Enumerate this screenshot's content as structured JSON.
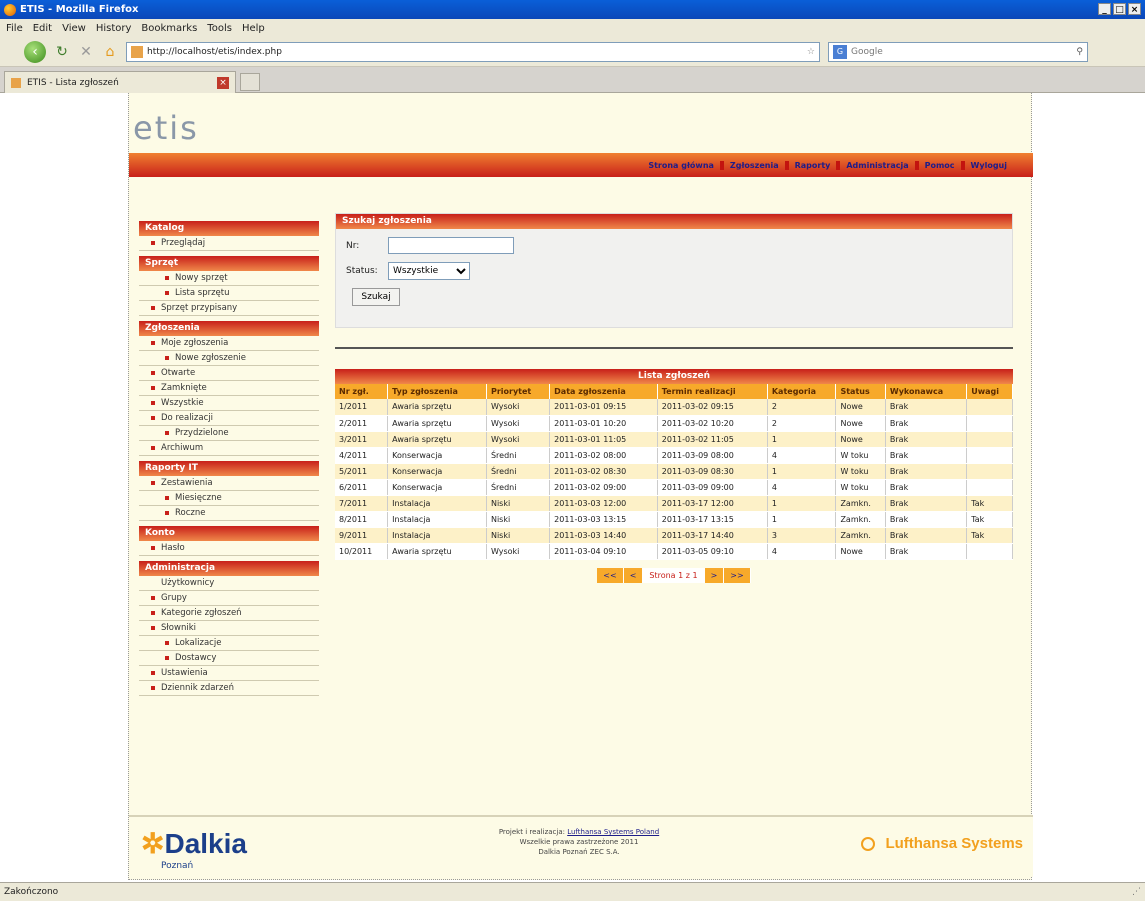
{
  "browser": {
    "title": "ETIS - Mozilla Firefox",
    "menu": [
      "File",
      "Edit",
      "View",
      "History",
      "Bookmarks",
      "Tools",
      "Help"
    ],
    "url": "http://localhost/etis/index.php",
    "search_placeholder": "Google",
    "tab_title": "ETIS - Lista zgłoszeń",
    "status": "Zakończono"
  },
  "header": {
    "logo": "etis",
    "nav": [
      "Strona główna",
      "Zgłoszenia",
      "Raporty",
      "Administracja",
      "Pomoc",
      "Wyloguj"
    ]
  },
  "sidebar": [
    {
      "heading": "Katalog",
      "items": [
        {
          "label": "Przeglądaj",
          "level": 1
        }
      ]
    },
    {
      "heading": "Sprzęt",
      "items": [
        {
          "label": "Nowy sprzęt",
          "level": 2
        },
        {
          "label": "Lista sprzętu",
          "level": 2
        },
        {
          "label": "Sprzęt przypisany",
          "level": 1
        }
      ]
    },
    {
      "heading": "Zgłoszenia",
      "items": [
        {
          "label": "Moje zgłoszenia",
          "level": 1
        },
        {
          "label": "Nowe zgłoszenie",
          "level": 2
        },
        {
          "label": "Otwarte",
          "level": 1
        },
        {
          "label": "Zamknięte",
          "level": 1
        },
        {
          "label": "Wszystkie",
          "level": 1
        },
        {
          "label": "Do realizacji",
          "level": 1
        },
        {
          "label": "Przydzielone",
          "level": 2
        },
        {
          "label": "Archiwum",
          "level": 1
        }
      ]
    },
    {
      "heading": "Raporty IT",
      "items": [
        {
          "label": "Zestawienia",
          "level": 1
        },
        {
          "label": "Miesięczne",
          "level": 2
        },
        {
          "label": "Roczne",
          "level": 2
        }
      ]
    },
    {
      "heading": "Konto",
      "items": [
        {
          "label": "Hasło",
          "level": 1
        }
      ]
    },
    {
      "heading": "Administracja",
      "items": [
        {
          "label": "Użytkownicy",
          "level": 0
        },
        {
          "label": "Grupy",
          "level": 1
        },
        {
          "label": "Kategorie zgłoszeń",
          "level": 1
        },
        {
          "label": "Słowniki",
          "level": 1
        },
        {
          "label": "Lokalizacje",
          "level": 2
        },
        {
          "label": "Dostawcy",
          "level": 2
        },
        {
          "label": "Ustawienia",
          "level": 1
        },
        {
          "label": "Dziennik zdarzeń",
          "level": 1
        }
      ]
    }
  ],
  "filter": {
    "title": "Szukaj zgłoszenia",
    "nr_label": "Nr:",
    "nr_value": "",
    "status_label": "Status:",
    "status_value": "Wszystkie",
    "submit": "Szukaj"
  },
  "table": {
    "title": "Lista zgłoszeń",
    "headers": [
      "Nr zgł.",
      "Typ zgłoszenia",
      "Priorytet",
      "Data zgłoszenia",
      "Termin realizacji",
      "Kategoria",
      "Status",
      "Wykonawca",
      "Uwagi"
    ],
    "rows": [
      [
        "1/2011",
        "Awaria sprzętu",
        "Wysoki",
        "2011-03-01 09:15",
        "2011-03-02 09:15",
        "2",
        "Nowe",
        "Brak",
        ""
      ],
      [
        "2/2011",
        "Awaria sprzętu",
        "Wysoki",
        "2011-03-01 10:20",
        "2011-03-02 10:20",
        "2",
        "Nowe",
        "Brak",
        ""
      ],
      [
        "3/2011",
        "Awaria sprzętu",
        "Wysoki",
        "2011-03-01 11:05",
        "2011-03-02 11:05",
        "1",
        "Nowe",
        "Brak",
        ""
      ],
      [
        "4/2011",
        "Konserwacja",
        "Średni",
        "2011-03-02 08:00",
        "2011-03-09 08:00",
        "4",
        "W toku",
        "Brak",
        ""
      ],
      [
        "5/2011",
        "Konserwacja",
        "Średni",
        "2011-03-02 08:30",
        "2011-03-09 08:30",
        "1",
        "W toku",
        "Brak",
        ""
      ],
      [
        "6/2011",
        "Konserwacja",
        "Średni",
        "2011-03-02 09:00",
        "2011-03-09 09:00",
        "4",
        "W toku",
        "Brak",
        ""
      ],
      [
        "7/2011",
        "Instalacja",
        "Niski",
        "2011-03-03 12:00",
        "2011-03-17 12:00",
        "1",
        "Zamkn.",
        "Brak",
        "Tak"
      ],
      [
        "8/2011",
        "Instalacja",
        "Niski",
        "2011-03-03 13:15",
        "2011-03-17 13:15",
        "1",
        "Zamkn.",
        "Brak",
        "Tak"
      ],
      [
        "9/2011",
        "Instalacja",
        "Niski",
        "2011-03-03 14:40",
        "2011-03-17 14:40",
        "3",
        "Zamkn.",
        "Brak",
        "Tak"
      ],
      [
        "10/2011",
        "Awaria sprzętu",
        "Wysoki",
        "2011-03-04 09:10",
        "2011-03-05 09:10",
        "4",
        "Nowe",
        "Brak",
        ""
      ]
    ]
  },
  "pager": {
    "first": "<<",
    "prev": "<",
    "current": "Strona 1 z 1",
    "next": ">",
    "last": ">>"
  },
  "footer": {
    "left_logo": "Dalkia",
    "left_sub": "Poznań",
    "line1_pre": "Projekt i realizacja: ",
    "line1_link": "Lufthansa Systems Poland",
    "line2": "Wszelkie prawa zastrzeżone 2011",
    "line3": "Dalkia Poznań ZEC S.A.",
    "right_logo": "Lufthansa Systems"
  }
}
